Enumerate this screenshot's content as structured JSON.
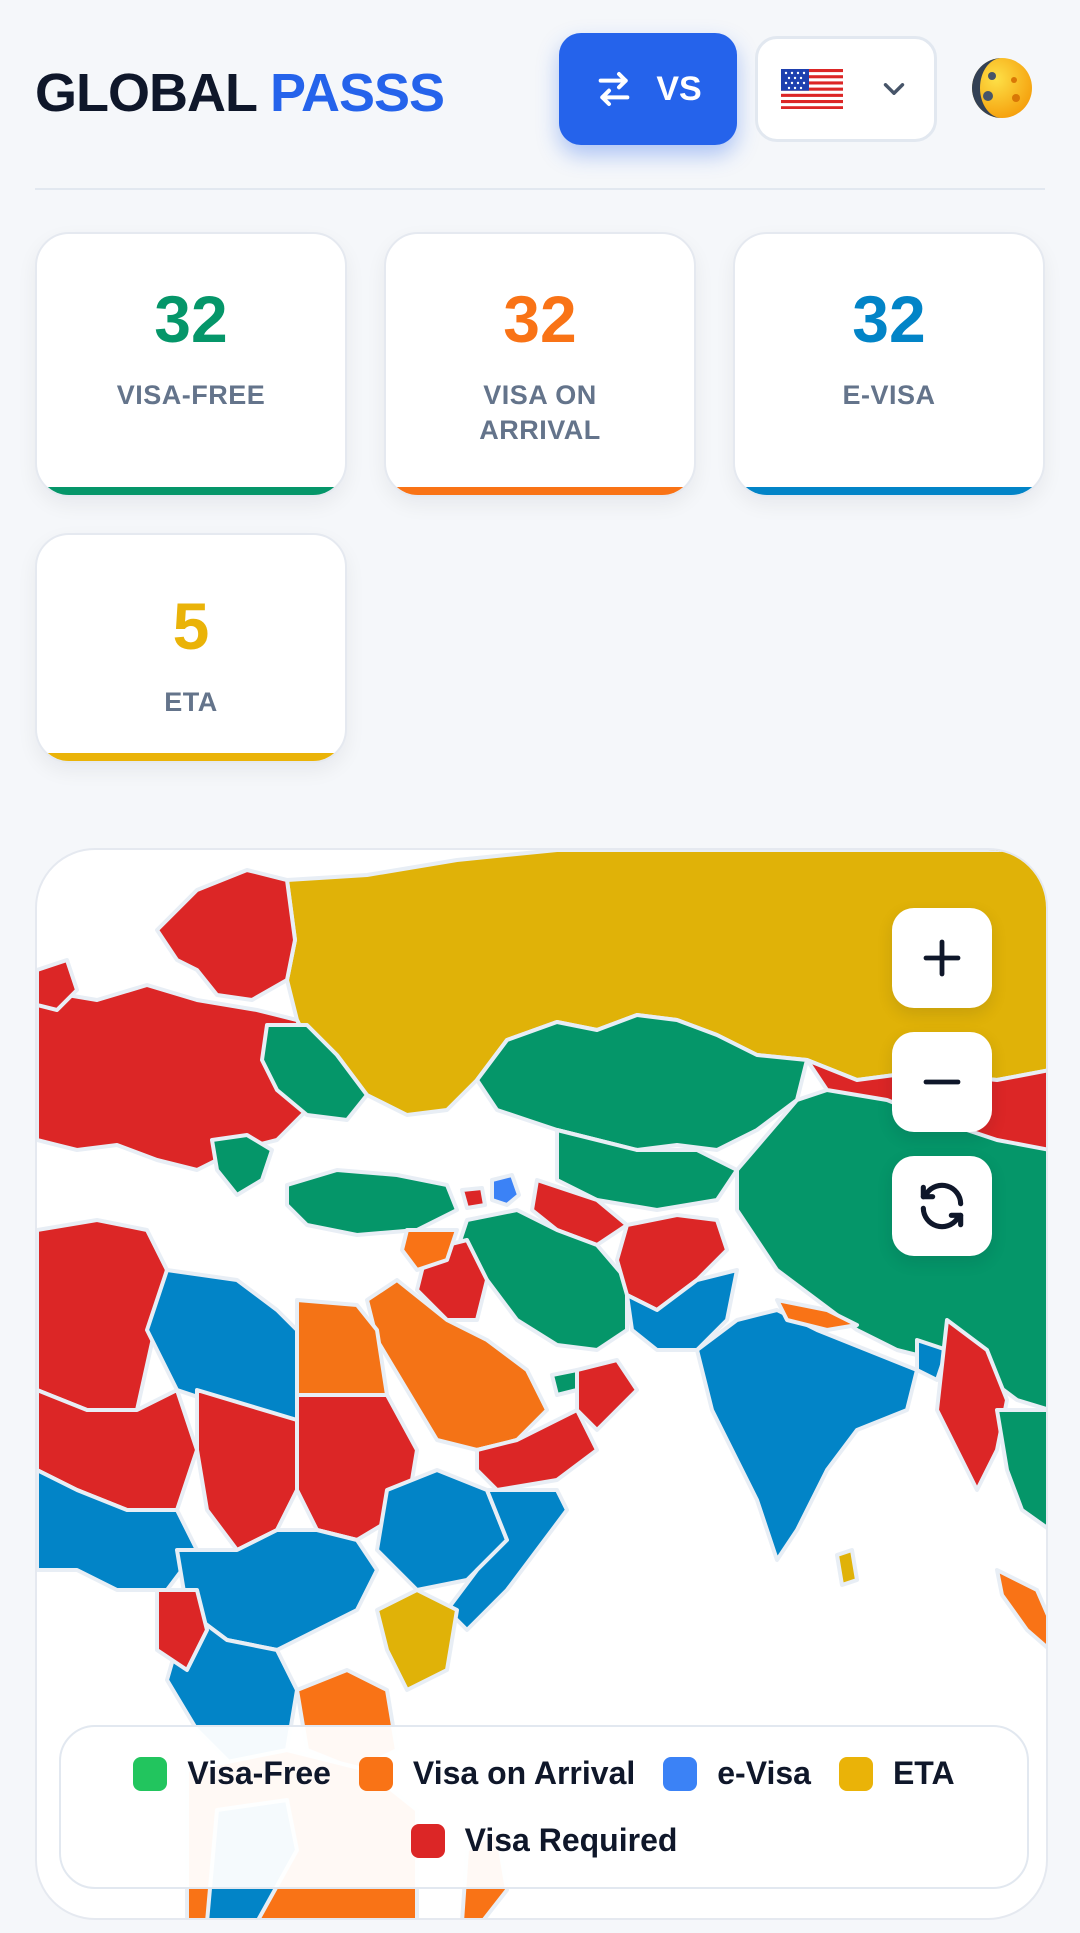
{
  "header": {
    "logo_part1": "GLOBAL",
    "logo_part2": "PASSS",
    "vs_label": "VS",
    "selected_country_flag": "🇺🇸",
    "icons": [
      "swap-arrows-icon",
      "chevron-down-icon",
      "theme-moon-sun-icon"
    ]
  },
  "stats": [
    {
      "value": "32",
      "label": "VISA-FREE",
      "color": "#059669"
    },
    {
      "value": "32",
      "label": "VISA ON ARRIVAL",
      "color": "#f97316"
    },
    {
      "value": "32",
      "label": "E-VISA",
      "color": "#0284c7"
    },
    {
      "value": "5",
      "label": "ETA",
      "color": "#eab308"
    }
  ],
  "map": {
    "controls": [
      "zoom-in-icon",
      "zoom-out-icon",
      "reset-icon"
    ]
  },
  "legend": [
    {
      "label": "Visa-Free",
      "color": "#22c55e"
    },
    {
      "label": "Visa on Arrival",
      "color": "#f97316"
    },
    {
      "label": "e-Visa",
      "color": "#3b82f6"
    },
    {
      "label": "ETA",
      "color": "#eab308"
    },
    {
      "label": "Visa Required",
      "color": "#dc2626"
    }
  ],
  "colors": {
    "visa_free_map": "#059669",
    "arrival_map": "#f47316",
    "evisa_map": "#0284c7",
    "eta_map": "#e0b208",
    "required_map": "#dc2626",
    "accent": "#2563eb"
  }
}
